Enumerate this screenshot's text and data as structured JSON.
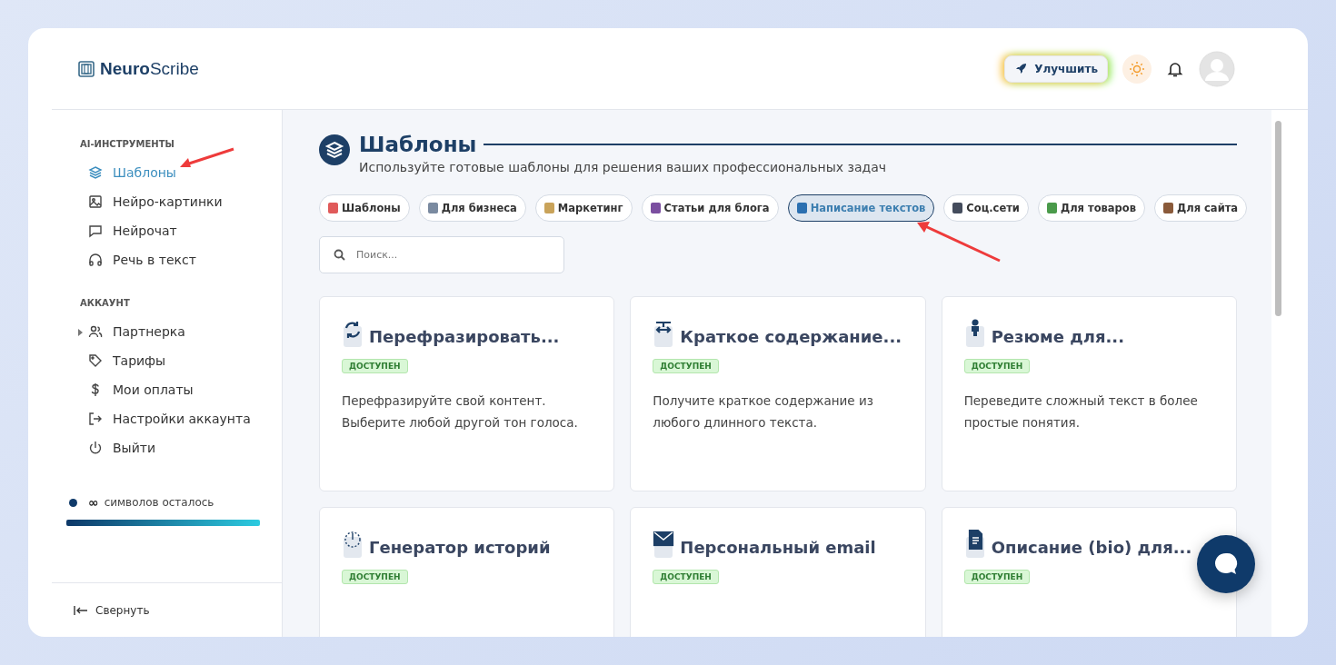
{
  "logo": {
    "bold": "Neuro",
    "light": "Scribe"
  },
  "header": {
    "upgrade_label": "Улучшить"
  },
  "sidebar": {
    "sections": [
      {
        "title": "AI-ИНСТРУМЕНТЫ",
        "items": [
          {
            "label": "Шаблоны",
            "kind": "layers",
            "selected": true,
            "expandable": false
          },
          {
            "label": "Нейро-картинки",
            "kind": "image",
            "selected": false,
            "expandable": false
          },
          {
            "label": "Нейрочат",
            "kind": "chat",
            "selected": false,
            "expandable": false
          },
          {
            "label": "Речь в текст",
            "kind": "headphones",
            "selected": false,
            "expandable": false
          }
        ]
      },
      {
        "title": "АККАУНТ",
        "items": [
          {
            "label": "Партнерка",
            "kind": "users",
            "selected": false,
            "expandable": true
          },
          {
            "label": "Тарифы",
            "kind": "tag",
            "selected": false,
            "expandable": false
          },
          {
            "label": "Мои оплаты",
            "kind": "dollar",
            "selected": false,
            "expandable": false
          },
          {
            "label": "Настройки аккаунта",
            "kind": "logout",
            "selected": false,
            "expandable": false
          },
          {
            "label": "Выйти",
            "kind": "power",
            "selected": false,
            "expandable": false
          }
        ]
      }
    ],
    "credits": {
      "amount": "∞",
      "label": "символов осталось",
      "level": 1
    },
    "collapse_label": "Свернуть"
  },
  "page": {
    "title": "Шаблоны",
    "subtitle": "Используйте готовые шаблоны для решения ваших профессиональных задач"
  },
  "categories": [
    {
      "label": "Шаблоны",
      "color": "#e05a5a",
      "selected": false
    },
    {
      "label": "Для бизнеса",
      "color": "#7a8aa0",
      "selected": false
    },
    {
      "label": "Маркетинг",
      "color": "#c9a35a",
      "selected": false
    },
    {
      "label": "Статьи для блога",
      "color": "#7b4fa0",
      "selected": false
    },
    {
      "label": "Написание текстов",
      "color": "#2a6fb0",
      "selected": true
    },
    {
      "label": "Соц.сети",
      "color": "#444c5c",
      "selected": false
    },
    {
      "label": "Для товаров",
      "color": "#4a9a4a",
      "selected": false
    },
    {
      "label": "Для сайта",
      "color": "#8a5a3a",
      "selected": false
    }
  ],
  "search": {
    "placeholder": "Поиск..."
  },
  "cards": [
    {
      "title": "Перефразировать...",
      "kind": "refresh",
      "badge": "ДОСТУПЕН",
      "description": "Перефразируйте свой контент. Выберите любой другой тон голоса."
    },
    {
      "title": "Краткое содержание...",
      "kind": "arrows",
      "badge": "ДОСТУПЕН",
      "description": "Получите краткое содержание из любого длинного текста."
    },
    {
      "title": "Резюме для...",
      "kind": "person",
      "badge": "ДОСТУПЕН",
      "description": "Переведите сложный текст в более простые понятия."
    },
    {
      "title": "Генератор историй",
      "kind": "clock",
      "badge": "ДОСТУПЕН"
    },
    {
      "title": "Персональный email",
      "kind": "mail",
      "badge": "ДОСТУПЕН"
    },
    {
      "title": "Описание (bio) для...",
      "kind": "document",
      "badge": "ДОСТУПЕН"
    }
  ]
}
